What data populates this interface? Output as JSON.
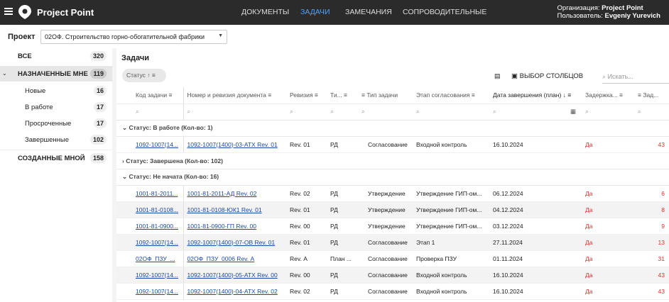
{
  "app": {
    "name": "Project Point"
  },
  "nav": {
    "items": [
      "ДОКУМЕНТЫ",
      "ЗАДАЧИ",
      "ЗАМЕЧАНИЯ",
      "СОПРОВОДИТЕЛЬНЫЕ"
    ],
    "active": "ЗАДАЧИ"
  },
  "org": {
    "org_label": "Организация:",
    "org_value": "Project Point",
    "user_label": "Пользователь:",
    "user_value": "Evgeniy Yurevich"
  },
  "project": {
    "label": "Проект",
    "value": "02ОФ. Строительство горно-обогатительной фабрики"
  },
  "sidebar": {
    "items": [
      {
        "label": "ВСЕ",
        "count": "320"
      },
      {
        "label": "НАЗНАЧЕННЫЕ МНЕ",
        "count": "119"
      },
      {
        "label": "Новые",
        "count": "16"
      },
      {
        "label": "В работе",
        "count": "17"
      },
      {
        "label": "Просроченные",
        "count": "17"
      },
      {
        "label": "Завершенные",
        "count": "102"
      },
      {
        "label": "СОЗДАННЫЕ МНОЙ",
        "count": "158"
      }
    ]
  },
  "main": {
    "title": "Задачи",
    "chip": "Статус",
    "columns_button": "ВЫБОР СТОЛБЦОВ",
    "search_placeholder": "Искать..."
  },
  "columns": [
    "Код задачи",
    "Номер и ревизия документа",
    "Ревизия",
    "Ти...",
    "Тип задачи",
    "Этап согласования",
    "Дата завершения (план)",
    "Задержка...",
    "Зад..."
  ],
  "groups": [
    {
      "label": "Статус: В работе (Кол-во: 1)",
      "rows": [
        [
          "1092-1007(14...",
          "1092-1007(1400)-03-АТХ Rev. 01",
          "Rev. 01",
          "РД",
          "Согласование",
          "Входной контроль",
          "16.10.2024",
          "Да",
          "43"
        ]
      ]
    },
    {
      "label": "Статус: Завершена (Кол-во: 102)",
      "rows": []
    },
    {
      "label": "Статус: Не начата (Кол-во: 16)",
      "rows": [
        [
          "1001-81-2011...",
          "1001-81-2011-АД Rev. 02",
          "Rev. 02",
          "РД",
          "Утверждение",
          "Утверждение ГИП-ом...",
          "06.12.2024",
          "Да",
          "6"
        ],
        [
          "1001-81-0108...",
          "1001-81-0108-ЮК1 Rev. 01",
          "Rev. 01",
          "РД",
          "Утверждение",
          "Утверждение ГИП-ом...",
          "04.12.2024",
          "Да",
          "8"
        ],
        [
          "1001-81-0900...",
          "1001-81-0900-ГП Rev. 00",
          "Rev. 00",
          "РД",
          "Утверждение",
          "Утверждение ГИП-ом...",
          "03.12.2024",
          "Да",
          "9"
        ],
        [
          "1092-1007(14...",
          "1092-1007(1400)-07-ОВ Rev. 01",
          "Rev. 01",
          "РД",
          "Согласование",
          "Этап 1",
          "27.11.2024",
          "Да",
          "13"
        ],
        [
          "02ОФ_ПЗУ_...",
          "02ОФ_ПЗУ_0006 Rev. А",
          "Rev. А",
          "План ...",
          "Согласование",
          "Проверка ПЗУ",
          "01.11.2024",
          "Да",
          "31"
        ],
        [
          "1092-1007(14...",
          "1092-1007(1400)-05-АТХ Rev. 00",
          "Rev. 00",
          "РД",
          "Согласование",
          "Входной контроль",
          "16.10.2024",
          "Да",
          "43"
        ],
        [
          "1092-1007(14...",
          "1092-1007(1400)-04-АТХ Rev. 02",
          "Rev. 02",
          "РД",
          "Согласование",
          "Входной контроль",
          "16.10.2024",
          "Да",
          "43"
        ]
      ]
    }
  ]
}
